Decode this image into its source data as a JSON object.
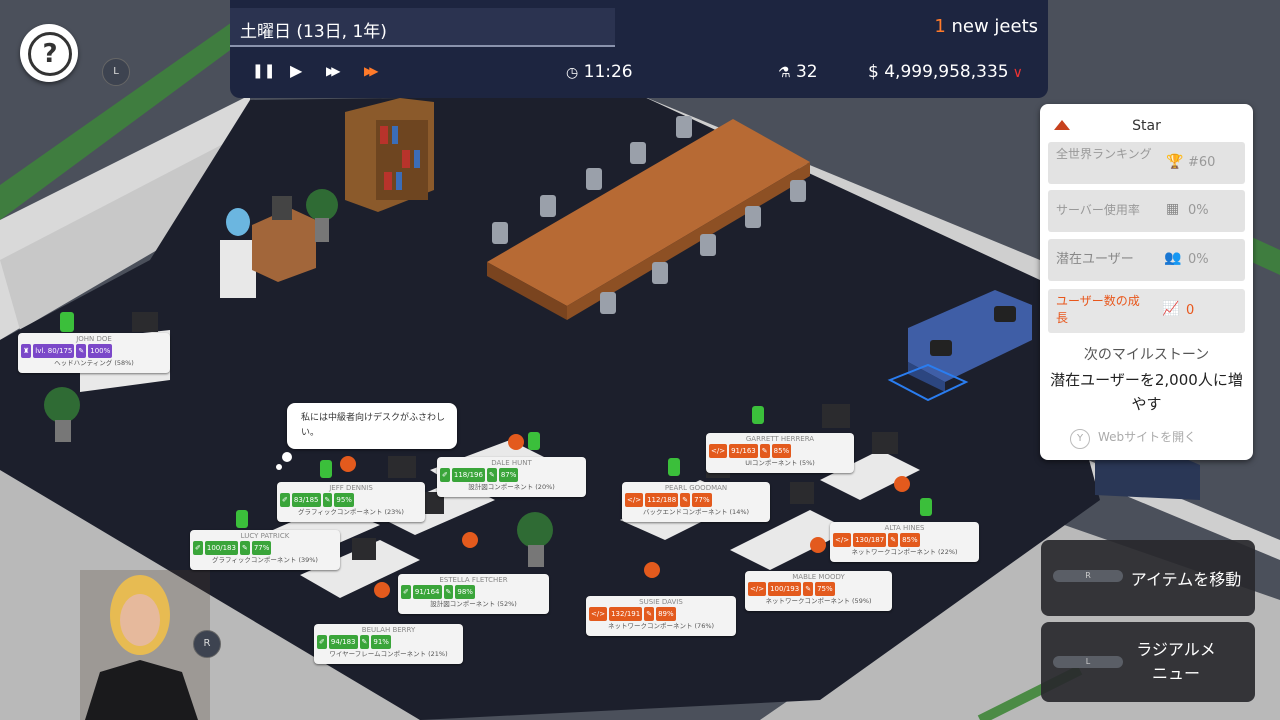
{
  "topbar": {
    "date": "土曜日 (13日, 1年)",
    "jeets_count": "1",
    "jeets_label": " new jeets",
    "time": "11:26",
    "research": "32",
    "money": "$ 4,999,958,335",
    "controls": {
      "pause": "❚❚",
      "play": "▶",
      "fast": "▶▶",
      "fastest": "▶▶"
    }
  },
  "help": {
    "label": "?",
    "key": "L"
  },
  "panel": {
    "title": "Star",
    "stats": [
      {
        "label": "全世界ランキング",
        "value": "#60",
        "icon": "trophy-icon"
      },
      {
        "label": "サーバー使用率",
        "value": "0%",
        "icon": "grid-icon"
      },
      {
        "label": "潜在ユーザー",
        "value": "0%",
        "icon": "users-icon"
      },
      {
        "label": "ユーザー数の成長",
        "value": "0",
        "icon": "chart-icon"
      }
    ],
    "milestone_heading": "次のマイルストーン",
    "milestone_text": "潜在ユーザーを2,000人に増やす",
    "web_key": "Y",
    "web_label": "Webサイトを開く"
  },
  "buttons": {
    "move_item": "アイテムを移動",
    "move_key": "R",
    "radial_menu": "ラジアルメニュー",
    "radial_key": "L"
  },
  "portrait_key": "R",
  "bubble": "私には中級者向けデスクがふさわしい。",
  "employees": [
    {
      "name": "JOHN DOE",
      "color": "p",
      "a": "lvl. 80/175",
      "b": "100%",
      "role": "ヘッドハンティング (58%)"
    },
    {
      "name": "JEFF DENNIS",
      "color": "g",
      "a": "83/185",
      "b": "95%",
      "role": "グラフィックコンポーネント (23%)"
    },
    {
      "name": "DALE HUNT",
      "color": "g",
      "a": "118/196",
      "b": "87%",
      "role": "設計図コンポーネント (20%)"
    },
    {
      "name": "LUCY PATRICK",
      "color": "g",
      "a": "100/183",
      "b": "77%",
      "role": "グラフィックコンポーネント (39%)"
    },
    {
      "name": "ESTELLA FLETCHER",
      "color": "g",
      "a": "91/164",
      "b": "98%",
      "role": "設計図コンポーネント (52%)"
    },
    {
      "name": "BEULAH BERRY",
      "color": "g",
      "a": "94/183",
      "b": "91%",
      "role": "ワイヤーフレームコンポーネント (21%)"
    },
    {
      "name": "GARRETT HERRERA",
      "color": "o",
      "a": "91/163",
      "b": "85%",
      "role": "UIコンポーネント (5%)"
    },
    {
      "name": "PEARL GOODMAN",
      "color": "o",
      "a": "112/188",
      "b": "77%",
      "role": "バックエンドコンポーネント (14%)"
    },
    {
      "name": "ALTA HINES",
      "color": "o",
      "a": "130/187",
      "b": "85%",
      "role": "ネットワークコンポーネント (22%)"
    },
    {
      "name": "MABLE MOODY",
      "color": "o",
      "a": "100/193",
      "b": "75%",
      "role": "ネットワークコンポーネント (59%)"
    },
    {
      "name": "SUSIE DAVIS",
      "color": "o",
      "a": "132/191",
      "b": "89%",
      "role": "ネットワークコンポーネント (76%)"
    }
  ]
}
